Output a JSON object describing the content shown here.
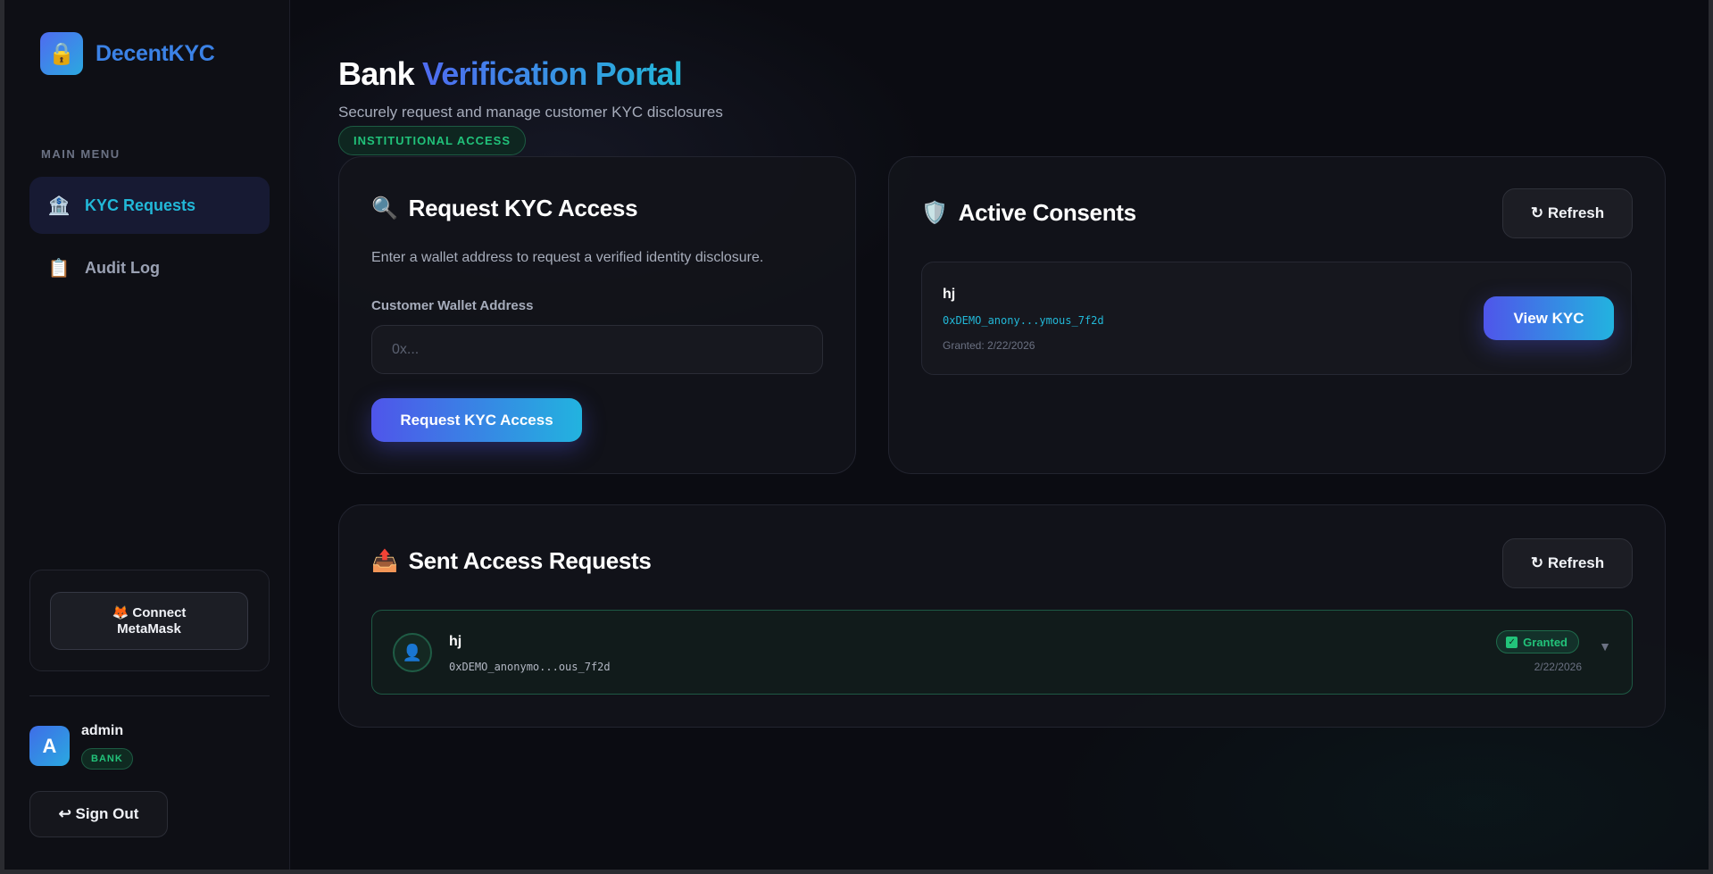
{
  "app": {
    "brand": "DecentKYC",
    "brand_icon": "lock-icon"
  },
  "sidebar": {
    "menu_title": "MAIN MENU",
    "items": [
      {
        "label": "KYC Requests",
        "icon": "bank-icon",
        "glyph": "🏦",
        "active": true
      },
      {
        "label": "Audit Log",
        "icon": "clipboard-icon",
        "glyph": "📋",
        "active": false
      }
    ],
    "connect_label_line1": "🦊 Connect",
    "connect_label_line2": "MetaMask",
    "user": {
      "initial": "A",
      "name": "admin",
      "role": "BANK"
    },
    "signout_label": "↩ Sign Out"
  },
  "header": {
    "title_plain": "Bank",
    "title_accent": "Verification Portal",
    "subtitle": "Securely request and manage customer KYC disclosures",
    "badge": "INSTITUTIONAL ACCESS"
  },
  "request_card": {
    "title": "Request KYC Access",
    "icon_glyph": "🔍",
    "description": "Enter a wallet address to request a verified identity disclosure.",
    "field_label": "Customer Wallet Address",
    "placeholder": "0x...",
    "value": "",
    "button_label": "Request KYC Access"
  },
  "consents_card": {
    "title": "Active Consents",
    "icon_glyph": "🛡️",
    "refresh_label": "↻ Refresh",
    "items": [
      {
        "name": "hj",
        "address": "0xDEMO_anony...ymous_7f2d",
        "granted": "Granted: 2/22/2026",
        "button_label": "View KYC"
      }
    ]
  },
  "sent_card": {
    "title": "Sent Access Requests",
    "icon_glyph": "📤",
    "refresh_label": "↻ Refresh",
    "items": [
      {
        "avatar_glyph": "👤",
        "name": "hj",
        "address": "0xDEMO_anonymo...ous_7f2d",
        "status": "Granted",
        "date": "2/22/2026"
      }
    ]
  },
  "colors": {
    "accent_blue": "#4f6bf0",
    "accent_cyan": "#22b8d8",
    "success": "#22c37a"
  }
}
